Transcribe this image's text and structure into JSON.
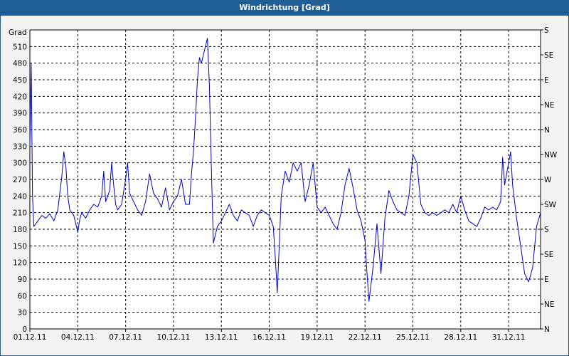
{
  "window": {
    "title": "Windrichtung [Grad]"
  },
  "colors": {
    "titlebar": "#1f5f96",
    "line": "#0000cc",
    "grid": "#000000",
    "plot_bg": "#ffffff",
    "panel_bg": "#f3f3f3"
  },
  "chart_data": {
    "type": "line",
    "title": "Windrichtung [Grad]",
    "ylabel": "Grad",
    "ylim": [
      0,
      540
    ],
    "xlim": [
      "01.12.11",
      "02.01.12"
    ],
    "y_ticks": [
      0,
      30,
      60,
      90,
      120,
      150,
      180,
      210,
      240,
      270,
      300,
      330,
      360,
      390,
      420,
      450,
      480,
      510
    ],
    "x_tick_labels": [
      "01.12.11",
      "04.12.11",
      "07.12.11",
      "10.12.11",
      "13.12.11",
      "16.12.11",
      "19.12.11",
      "22.12.11",
      "25.12.11",
      "28.12.11",
      "31.12.11"
    ],
    "right_axis_labels": [
      "N",
      "NE",
      "E",
      "SE",
      "S",
      "SW",
      "W",
      "NW",
      "N",
      "NE",
      "E",
      "SE",
      "S"
    ],
    "grid": true,
    "series": [
      {
        "values": [
          [
            "01.12.11 00:00",
            330
          ],
          [
            "01.12.11 02:00",
            480
          ],
          [
            "01.12.11 04:00",
            240
          ],
          [
            "01.12.11 06:00",
            185
          ],
          [
            "01.12.11 12:00",
            195
          ],
          [
            "01.12.11 18:00",
            205
          ],
          [
            "02.12.11 00:00",
            200
          ],
          [
            "02.12.11 06:00",
            208
          ],
          [
            "02.12.11 12:00",
            195
          ],
          [
            "02.12.11 18:00",
            215
          ],
          [
            "03.12.11 00:00",
            275
          ],
          [
            "03.12.11 03:00",
            320
          ],
          [
            "03.12.11 06:00",
            295
          ],
          [
            "03.12.11 09:00",
            240
          ],
          [
            "03.12.11 12:00",
            215
          ],
          [
            "03.12.11 18:00",
            205
          ],
          [
            "04.12.11 00:00",
            175
          ],
          [
            "04.12.11 03:00",
            198
          ],
          [
            "04.12.11 06:00",
            210
          ],
          [
            "04.12.11 12:00",
            200
          ],
          [
            "04.12.11 18:00",
            215
          ],
          [
            "05.12.11 00:00",
            225
          ],
          [
            "05.12.11 06:00",
            220
          ],
          [
            "05.12.11 12:00",
            240
          ],
          [
            "05.12.11 15:00",
            285
          ],
          [
            "05.12.11 18:00",
            230
          ],
          [
            "06.12.11 00:00",
            250
          ],
          [
            "06.12.11 03:00",
            300
          ],
          [
            "06.12.11 06:00",
            260
          ],
          [
            "06.12.11 09:00",
            225
          ],
          [
            "06.12.11 12:00",
            215
          ],
          [
            "06.12.11 18:00",
            225
          ],
          [
            "07.12.11 00:00",
            270
          ],
          [
            "07.12.11 03:00",
            300
          ],
          [
            "07.12.11 06:00",
            245
          ],
          [
            "07.12.11 12:00",
            230
          ],
          [
            "07.12.11 18:00",
            215
          ],
          [
            "08.12.11 00:00",
            205
          ],
          [
            "08.12.11 06:00",
            230
          ],
          [
            "08.12.11 12:00",
            280
          ],
          [
            "08.12.11 18:00",
            245
          ],
          [
            "09.12.11 00:00",
            235
          ],
          [
            "09.12.11 06:00",
            220
          ],
          [
            "09.12.11 12:00",
            255
          ],
          [
            "09.12.11 18:00",
            215
          ],
          [
            "10.12.11 00:00",
            230
          ],
          [
            "10.12.11 06:00",
            240
          ],
          [
            "10.12.11 12:00",
            270
          ],
          [
            "10.12.11 18:00",
            225
          ],
          [
            "11.12.11 00:00",
            225
          ],
          [
            "11.12.11 03:00",
            280
          ],
          [
            "11.12.11 06:00",
            320
          ],
          [
            "11.12.11 09:00",
            380
          ],
          [
            "11.12.11 12:00",
            450
          ],
          [
            "11.12.11 15:00",
            490
          ],
          [
            "11.12.11 18:00",
            480
          ],
          [
            "12.12.11 00:00",
            510
          ],
          [
            "12.12.11 03:00",
            525
          ],
          [
            "12.12.11 06:00",
            440
          ],
          [
            "12.12.11 09:00",
            290
          ],
          [
            "12.12.11 12:00",
            155
          ],
          [
            "12.12.11 18:00",
            185
          ],
          [
            "13.12.11 00:00",
            195
          ],
          [
            "13.12.11 06:00",
            210
          ],
          [
            "13.12.11 12:00",
            225
          ],
          [
            "13.12.11 18:00",
            205
          ],
          [
            "14.12.11 00:00",
            195
          ],
          [
            "14.12.11 06:00",
            215
          ],
          [
            "14.12.11 12:00",
            210
          ],
          [
            "14.12.11 18:00",
            205
          ],
          [
            "15.12.11 00:00",
            185
          ],
          [
            "15.12.11 06:00",
            205
          ],
          [
            "15.12.11 12:00",
            215
          ],
          [
            "15.12.11 18:00",
            210
          ],
          [
            "16.12.11 00:00",
            205
          ],
          [
            "16.12.11 06:00",
            185
          ],
          [
            "16.12.11 09:00",
            130
          ],
          [
            "16.12.11 12:00",
            65
          ],
          [
            "16.12.11 15:00",
            150
          ],
          [
            "16.12.11 18:00",
            240
          ],
          [
            "17.12.11 00:00",
            285
          ],
          [
            "17.12.11 06:00",
            265
          ],
          [
            "17.12.11 12:00",
            300
          ],
          [
            "17.12.11 18:00",
            285
          ],
          [
            "18.12.11 00:00",
            300
          ],
          [
            "18.12.11 06:00",
            230
          ],
          [
            "18.12.11 12:00",
            260
          ],
          [
            "18.12.11 18:00",
            300
          ],
          [
            "19.12.11 00:00",
            220
          ],
          [
            "19.12.11 06:00",
            210
          ],
          [
            "19.12.11 12:00",
            220
          ],
          [
            "19.12.11 18:00",
            205
          ],
          [
            "20.12.11 00:00",
            190
          ],
          [
            "20.12.11 06:00",
            180
          ],
          [
            "20.12.11 12:00",
            210
          ],
          [
            "20.12.11 18:00",
            260
          ],
          [
            "21.12.11 00:00",
            290
          ],
          [
            "21.12.11 06:00",
            255
          ],
          [
            "21.12.11 12:00",
            215
          ],
          [
            "21.12.11 18:00",
            195
          ],
          [
            "22.12.11 00:00",
            160
          ],
          [
            "22.12.11 03:00",
            100
          ],
          [
            "22.12.11 06:00",
            50
          ],
          [
            "22.12.11 12:00",
            110
          ],
          [
            "22.12.11 18:00",
            190
          ],
          [
            "23.12.11 00:00",
            100
          ],
          [
            "23.12.11 06:00",
            200
          ],
          [
            "23.12.11 12:00",
            250
          ],
          [
            "23.12.11 18:00",
            230
          ],
          [
            "24.12.11 00:00",
            215
          ],
          [
            "24.12.11 06:00",
            210
          ],
          [
            "24.12.11 12:00",
            205
          ],
          [
            "24.12.11 18:00",
            240
          ],
          [
            "25.12.11 00:00",
            315
          ],
          [
            "25.12.11 06:00",
            300
          ],
          [
            "25.12.11 12:00",
            225
          ],
          [
            "25.12.11 18:00",
            210
          ],
          [
            "26.12.11 00:00",
            205
          ],
          [
            "26.12.11 06:00",
            210
          ],
          [
            "26.12.11 12:00",
            205
          ],
          [
            "26.12.11 18:00",
            210
          ],
          [
            "27.12.11 00:00",
            215
          ],
          [
            "27.12.11 06:00",
            210
          ],
          [
            "27.12.11 12:00",
            225
          ],
          [
            "27.12.11 18:00",
            210
          ],
          [
            "28.12.11 00:00",
            240
          ],
          [
            "28.12.11 06:00",
            215
          ],
          [
            "28.12.11 12:00",
            195
          ],
          [
            "28.12.11 18:00",
            190
          ],
          [
            "29.12.11 00:00",
            185
          ],
          [
            "29.12.11 06:00",
            200
          ],
          [
            "29.12.11 12:00",
            220
          ],
          [
            "29.12.11 18:00",
            215
          ],
          [
            "30.12.11 00:00",
            220
          ],
          [
            "30.12.11 06:00",
            215
          ],
          [
            "30.12.11 12:00",
            230
          ],
          [
            "30.12.11 15:00",
            310
          ],
          [
            "30.12.11 18:00",
            260
          ],
          [
            "31.12.11 00:00",
            300
          ],
          [
            "31.12.11 03:00",
            320
          ],
          [
            "31.12.11 06:00",
            260
          ],
          [
            "31.12.11 12:00",
            200
          ],
          [
            "31.12.11 18:00",
            150
          ],
          [
            "01.01.12 00:00",
            100
          ],
          [
            "01.01.12 06:00",
            85
          ],
          [
            "01.01.12 12:00",
            110
          ],
          [
            "01.01.12 18:00",
            185
          ],
          [
            "02.01.12 00:00",
            210
          ]
        ]
      }
    ]
  }
}
